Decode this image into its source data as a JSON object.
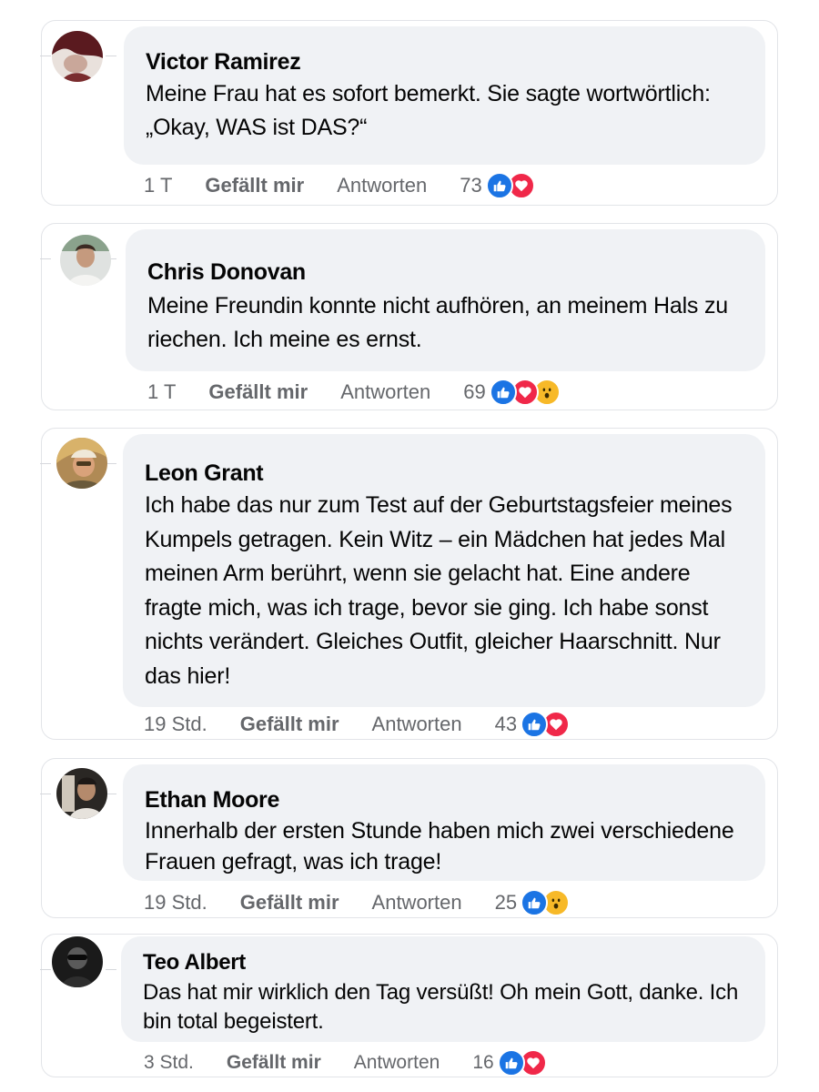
{
  "comments": [
    {
      "author": "Victor Ramirez",
      "text": "Meine Frau hat es sofort bemerkt. Sie sagte wortwörtlich: „Okay, WAS ist DAS?“",
      "time": "1 T",
      "like_label": "Gefällt mir",
      "reply_label": "Antworten",
      "reaction_count": "73",
      "reactions": [
        "like",
        "love"
      ]
    },
    {
      "author": "Chris Donovan",
      "text": "Meine Freundin konnte nicht aufhören, an meinem Hals zu riechen. Ich meine es ernst.",
      "time": "1 T",
      "like_label": "Gefällt mir",
      "reply_label": "Antworten",
      "reaction_count": "69",
      "reactions": [
        "like",
        "love",
        "wow"
      ]
    },
    {
      "author": "Leon Grant",
      "text": "Ich habe das nur zum Test auf der Geburtstagsfeier meines Kumpels getragen. Kein Witz – ein Mädchen hat jedes Mal meinen Arm berührt, wenn sie gelacht hat. Eine andere fragte mich, was ich trage, bevor sie ging. Ich habe sonst nichts verändert. Gleiches Outfit, gleicher Haarschnitt. Nur das hier!",
      "time": "19 Std.",
      "like_label": "Gefällt mir",
      "reply_label": "Antworten",
      "reaction_count": "43",
      "reactions": [
        "like",
        "love"
      ]
    },
    {
      "author": "Ethan Moore",
      "text": "Innerhalb der ersten Stunde haben mich zwei verschiedene Frauen gefragt, was ich trage!",
      "time": "19 Std.",
      "like_label": "Gefällt mir",
      "reply_label": "Antworten",
      "reaction_count": "25",
      "reactions": [
        "like",
        "wow"
      ]
    },
    {
      "author": "Teo Albert",
      "text": "Das hat mir wirklich den Tag versüßt! Oh mein Gott, danke. Ich bin total begeistert.",
      "time": "3 Std.",
      "like_label": "Gefällt mir",
      "reply_label": "Antworten",
      "reaction_count": "16",
      "reactions": [
        "like",
        "love"
      ]
    }
  ],
  "colors": {
    "bubble": "#f0f2f5",
    "meta_text": "#65676b",
    "like_reaction": "#1b74e4",
    "love_reaction": "#f02849",
    "wow_reaction": "#f7b928"
  }
}
